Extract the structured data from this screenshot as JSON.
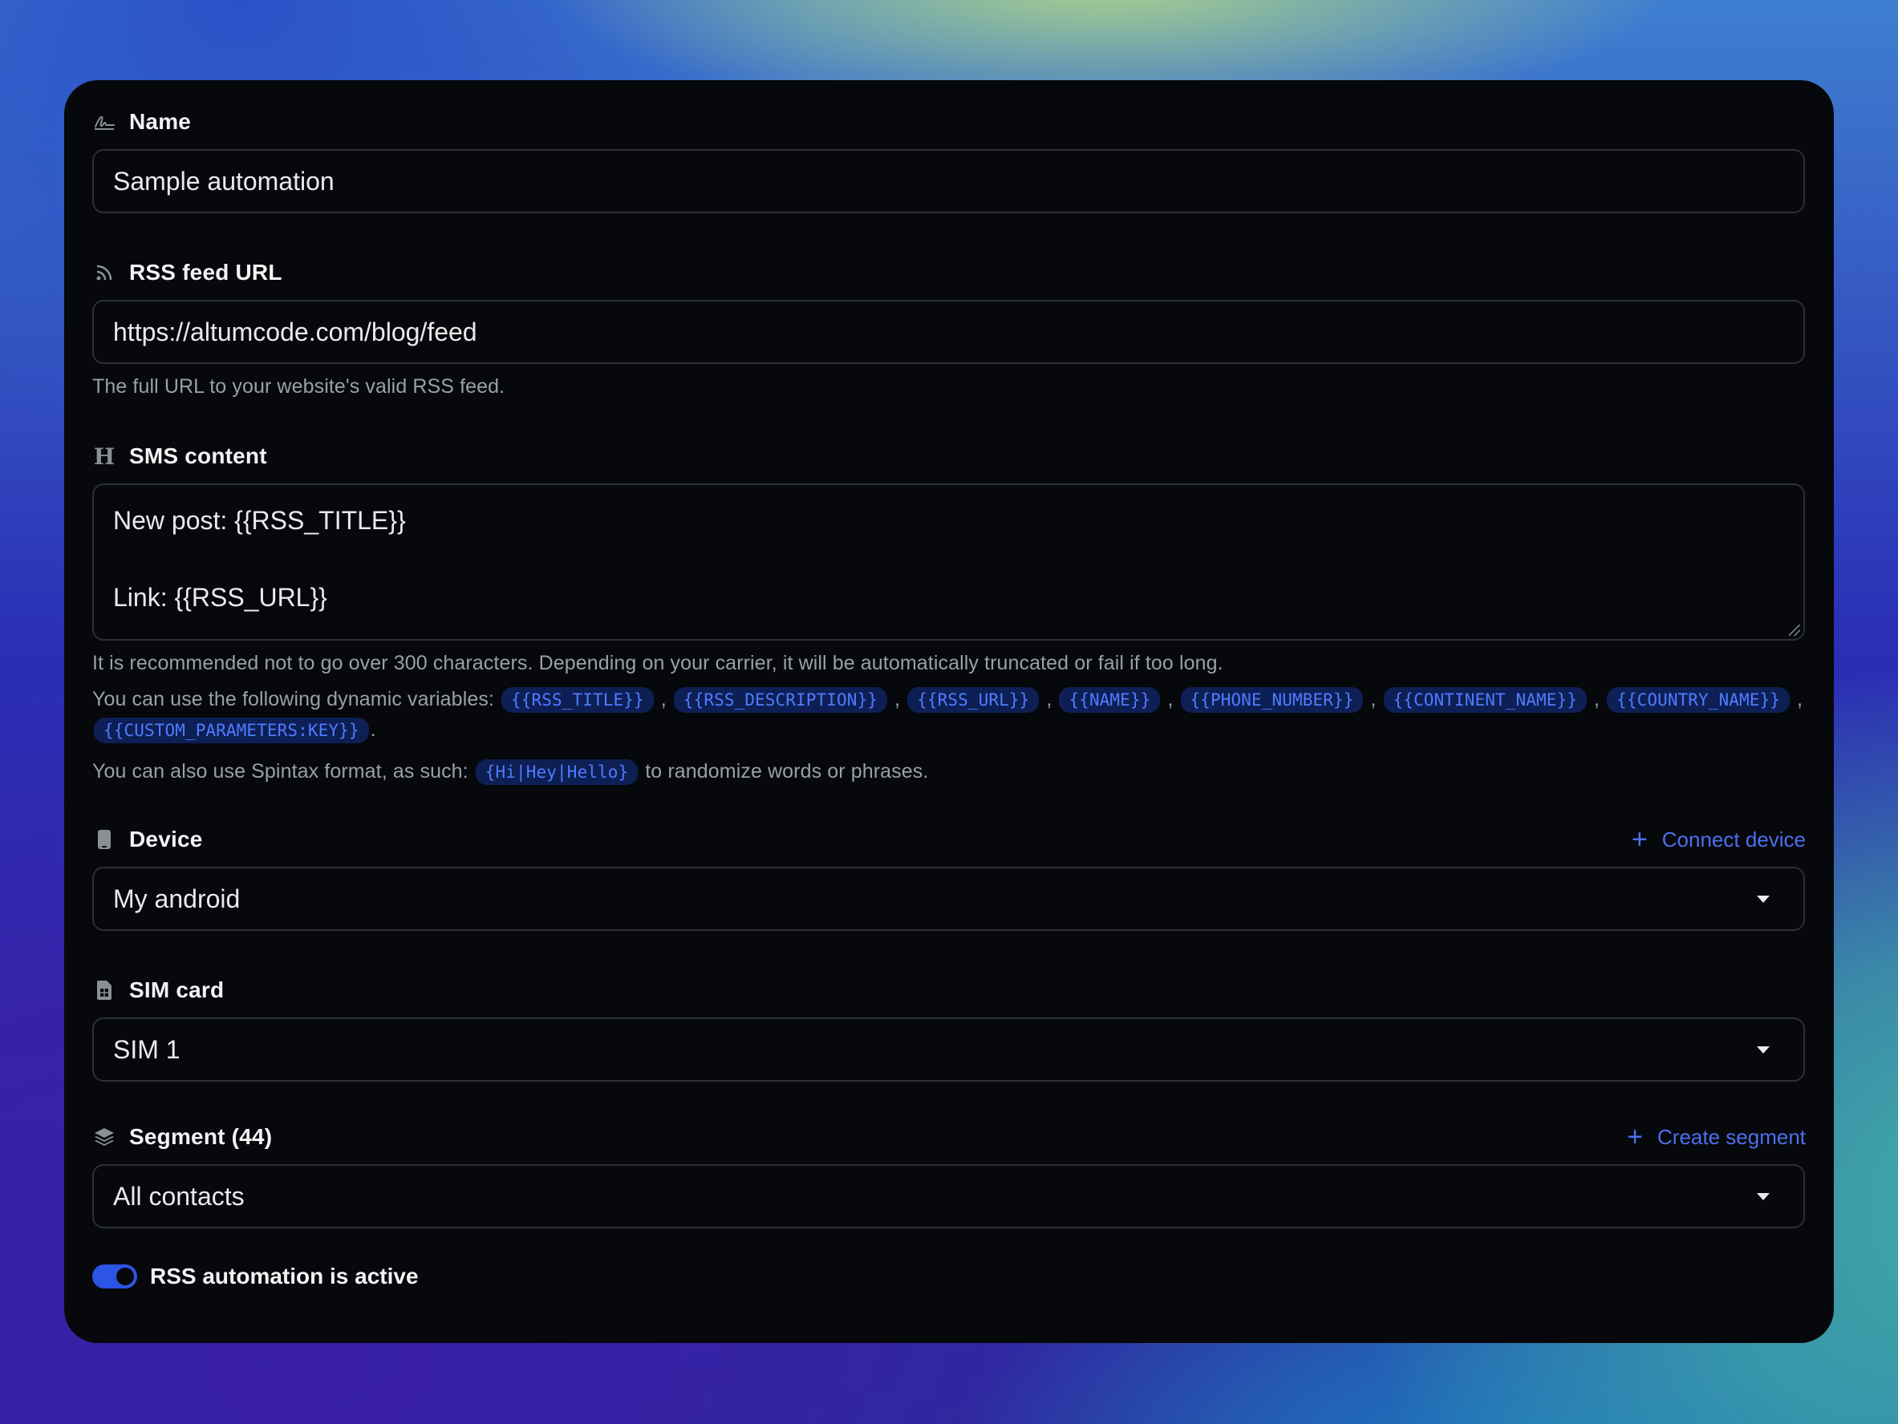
{
  "form": {
    "name": {
      "label": "Name",
      "icon": "signature-icon",
      "value": "Sample automation"
    },
    "rss_url": {
      "label": "RSS feed URL",
      "icon": "rss-icon",
      "value": "https://altumcode.com/blog/feed",
      "help": "The full URL to your website's valid RSS feed."
    },
    "sms_content": {
      "label": "SMS content",
      "icon": "heading-icon",
      "lines": [
        "New post: {{RSS_TITLE}}",
        "",
        "Link: {{RSS_URL}}"
      ],
      "help_limit": "It is recommended not to go over 300 characters. Depending on your carrier, it will be automatically truncated or fail if too long.",
      "help_variables_prefix": "You can use the following dynamic variables:",
      "variables": [
        "{{RSS_TITLE}}",
        "{{RSS_DESCRIPTION}}",
        "{{RSS_URL}}",
        "{{NAME}}",
        "{{PHONE_NUMBER}}",
        "{{CONTINENT_NAME}}",
        "{{COUNTRY_NAME}}",
        "{{CUSTOM_PARAMETERS:KEY}}"
      ],
      "help_spintax_prefix": "You can also use Spintax format, as such:",
      "spintax_example": "{Hi|Hey|Hello}",
      "help_spintax_suffix": "to randomize words or phrases."
    },
    "device": {
      "label": "Device",
      "icon": "mobile-icon",
      "link_label": "Connect device",
      "value": "My android"
    },
    "sim": {
      "label": "SIM card",
      "icon": "sim-card-icon",
      "value": "SIM 1"
    },
    "segment": {
      "label": "Segment (44)",
      "icon": "layers-icon",
      "link_label": "Create segment",
      "value": "All contacts"
    },
    "active_toggle": {
      "label": "RSS automation is active",
      "checked": true
    }
  },
  "colors": {
    "accent": "#2c55e6",
    "link": "#4d6ff0",
    "card_bg": "#06080b",
    "code_bg": "#0e1f55",
    "code_text": "#4f7cff"
  }
}
